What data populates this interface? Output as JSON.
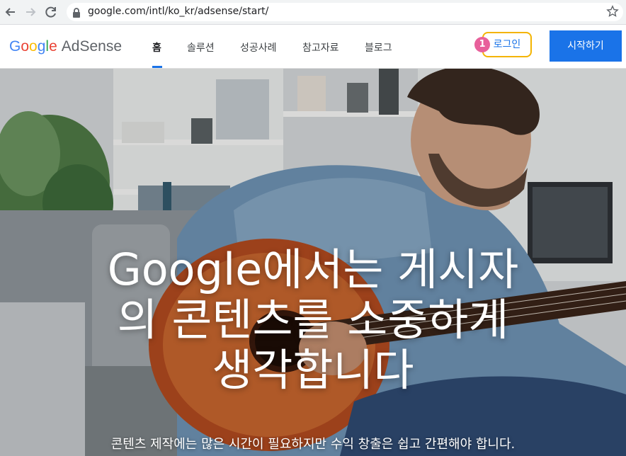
{
  "browser": {
    "url": "google.com/intl/ko_kr/adsense/start/"
  },
  "header": {
    "logo_google": "Google",
    "logo_product": "AdSense",
    "nav": [
      {
        "label": "홈",
        "active": true
      },
      {
        "label": "솔루션",
        "active": false
      },
      {
        "label": "성공사례",
        "active": false
      },
      {
        "label": "참고자료",
        "active": false
      },
      {
        "label": "블로그",
        "active": false
      }
    ],
    "step_badge": "1",
    "login_label": "로그인",
    "start_label": "시작하기"
  },
  "hero": {
    "headline_lines": [
      "Google에서는 게시자",
      "의 콘텐츠를 소중하게",
      "생각합니다"
    ],
    "subtext": "콘텐츠 제작에는 많은 시간이 필요하지만 수익 창출은 쉽고 간편해야 합니다."
  },
  "colors": {
    "brand_blue": "#1a73e8",
    "highlight_yellow": "#f4b400",
    "badge_pink": "#e8609b"
  }
}
